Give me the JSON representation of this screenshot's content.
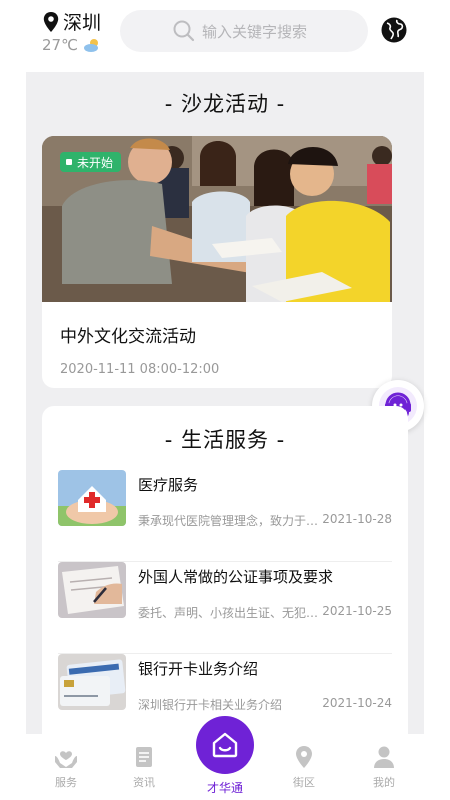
{
  "header": {
    "city": "深圳",
    "temperature": "27℃",
    "search_placeholder": "输入关键字搜索"
  },
  "salon": {
    "section_title": "- 沙龙活动 -",
    "event": {
      "status_badge": "未开始",
      "title": "中外文化交流活动",
      "time": "2020-11-11 08:00-12:00"
    }
  },
  "life_services": {
    "section_title": "- 生活服务 -",
    "items": [
      {
        "title": "医疗服务",
        "desc": "秉承现代医院管理理念，致力于为…",
        "date": "2021-10-28"
      },
      {
        "title": "外国人常做的公证事项及要求",
        "desc": "委托、声明、小孩出生证、无犯罪…",
        "date": "2021-10-25"
      },
      {
        "title": "银行开卡业务介绍",
        "desc": "深圳银行开卡相关业务介绍",
        "date": "2021-10-24"
      }
    ]
  },
  "nav": {
    "items": [
      {
        "label": "服务"
      },
      {
        "label": "资讯"
      },
      {
        "label": "才华通"
      },
      {
        "label": "街区"
      },
      {
        "label": "我的"
      }
    ]
  },
  "colors": {
    "accent": "#6f22d6",
    "badge": "#2fb36b"
  }
}
